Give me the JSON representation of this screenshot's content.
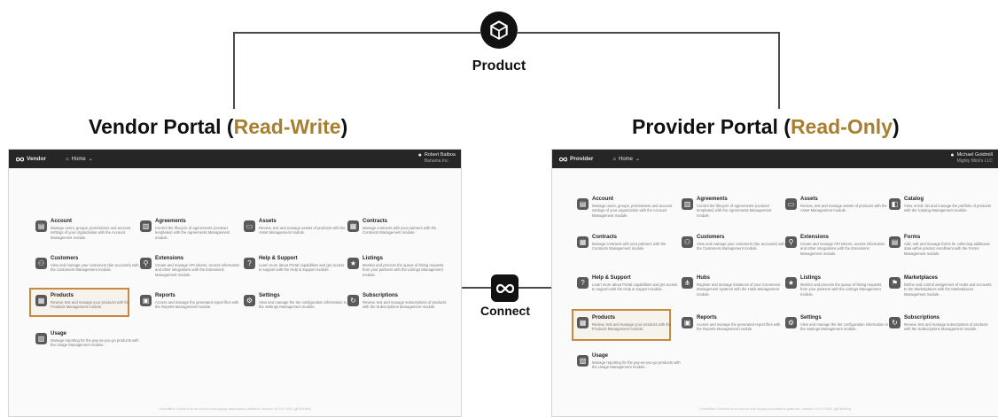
{
  "product": {
    "label": "Product",
    "icon": "cube-icon"
  },
  "connect": {
    "label": "Connect",
    "icon": "infinity-icon"
  },
  "vendor": {
    "title_main": "Vendor Portal (",
    "title_accent": "Read-Write",
    "title_end": ")",
    "brand": "Vendor",
    "nav": "Home",
    "user_name": "Robert Balboa",
    "user_org": "Bahama Inc.",
    "footer": "CloudBlue Connect is an end-to-end supply automation platform, version 19.0.0.0001 (gf7fd1f6a)"
  },
  "provider": {
    "title_main": "Provider Portal (",
    "title_accent": "Read-Only",
    "title_end": ")",
    "brand": "Provider",
    "nav": "Home",
    "user_name": "Michael Goldmill",
    "user_org": "Mighty Mick's LLC",
    "footer": "CloudBlue Connect is an end-to-end supply automation platform, version 19.0.0.0001 (gf7fd1f6a)"
  },
  "accent_color": "#a77f2e",
  "highlight_color": "#c8883e",
  "modules": {
    "account": {
      "title": "Account",
      "desc": "Manage users, groups, permissions and account settings of your organization with the Account Management module."
    },
    "agreements": {
      "title": "Agreements",
      "desc": "Control the lifecycle of agreements (contract templates) with the Agreements Management module."
    },
    "assets": {
      "title": "Assets",
      "desc": "Review, test and manage assets of products with the Asset Management module."
    },
    "contracts": {
      "title": "Contracts",
      "desc": "Manage contracts with your partners with the Contracts Management module."
    },
    "customers": {
      "title": "Customers",
      "desc": "View and manage your customers (tier accounts) with the Customers Management module."
    },
    "extensions": {
      "title": "Extensions",
      "desc": "Create and manage API tokens, access information and other integrations with the Extensions Management module."
    },
    "help": {
      "title": "Help & Support",
      "desc": "Learn more about Portal capabilities and get access to support with the Help & Support module."
    },
    "listings": {
      "title": "Listings",
      "desc": "Monitor and process the queue of listing requests from your partners with the Listings Management module."
    },
    "products": {
      "title": "Products",
      "desc": "Review, test and manage your products with the Products Management module."
    },
    "reports": {
      "title": "Reports",
      "desc": "Access and manage the generated report files with the Reports Management module."
    },
    "settings": {
      "title": "Settings",
      "desc": "View and manage the tier configuration information in the Settings Management module."
    },
    "subscriptions": {
      "title": "Subscriptions",
      "desc": "Review, test and manage subscriptions of products with the Subscriptions Management module."
    },
    "usage": {
      "title": "Usage",
      "desc": "Manage reporting for the pay-as-you-go products with the Usage Management module."
    },
    "catalog": {
      "title": "Catalog",
      "desc": "View, enroll, list and manage the portfolio of products with the Catalog Management module."
    },
    "forms": {
      "title": "Forms",
      "desc": "Add, edit and manage forms for collecting additional data within product enrollment with the Forms Management module."
    },
    "hubs": {
      "title": "Hubs",
      "desc": "Register and manage instances of your Commerce Management systems with the Hubs Management module."
    },
    "marketplaces": {
      "title": "Marketplaces",
      "desc": "Define and control assignment of Hubs and Accounts to the Marketplaces with the Marketplaces Management module."
    }
  }
}
